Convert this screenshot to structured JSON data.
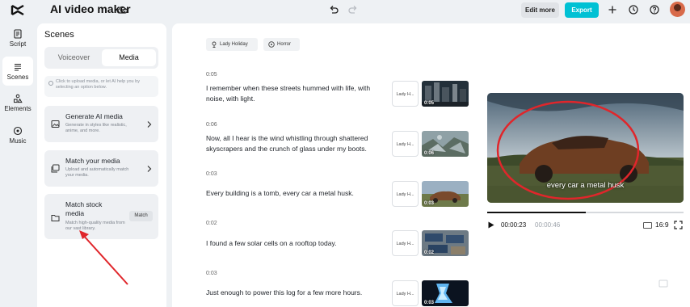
{
  "header": {
    "title": "AI video maker",
    "edit_more": "Edit more",
    "export": "Export"
  },
  "rail": {
    "items": [
      {
        "label": "Script",
        "icon": "script-icon"
      },
      {
        "label": "Scenes",
        "icon": "scenes-icon",
        "active": true
      },
      {
        "label": "Elements",
        "icon": "elements-icon"
      },
      {
        "label": "Music",
        "icon": "music-icon"
      }
    ]
  },
  "panel": {
    "title": "Scenes",
    "tabs": [
      "Voiceover",
      "Media"
    ],
    "active_tab": "Media",
    "hint": "Click  to upload media, or let AI help you by selecting an option below.",
    "cards": [
      {
        "title": "Generate AI media",
        "desc": "Generate in styles like realistic, anime, and more."
      },
      {
        "title": "Match your media",
        "desc": "Upload and automatically match your media."
      },
      {
        "title": "Match stock media",
        "desc": "Match high-quality media from our vast library.",
        "button": "Match"
      }
    ]
  },
  "tags": [
    "Lady Holiday",
    "Horror"
  ],
  "scenes": [
    {
      "time": "0:05",
      "text": "I remember when these streets hummed with life, with noise, with light.",
      "voice": "Lady H...",
      "thumb_label": "0:05"
    },
    {
      "time": "0:06",
      "text": "Now, all I hear is the wind whistling through shattered skyscrapers and the crunch of glass under my boots.",
      "voice": "Lady H...",
      "thumb_label": "0:06"
    },
    {
      "time": "0:03",
      "text": "Every building is a tomb, every car a metal husk.",
      "voice": "Lady H...",
      "thumb_label": "0:03"
    },
    {
      "time": "0:02",
      "text": "I found a few solar cells on a rooftop today.",
      "voice": "Lady H...",
      "thumb_label": "0:02"
    },
    {
      "time": "0:03",
      "text": "Just enough to power this log for a few more hours.",
      "voice": "Lady H...",
      "thumb_label": "0:03"
    }
  ],
  "player": {
    "caption": "every car a metal husk",
    "current_time": "00:00:23",
    "total_time": "00:00:46",
    "progress": 0.5,
    "aspect": "16:9"
  },
  "colors": {
    "accent": "#00c1d4",
    "annotation": "#e0262b"
  }
}
